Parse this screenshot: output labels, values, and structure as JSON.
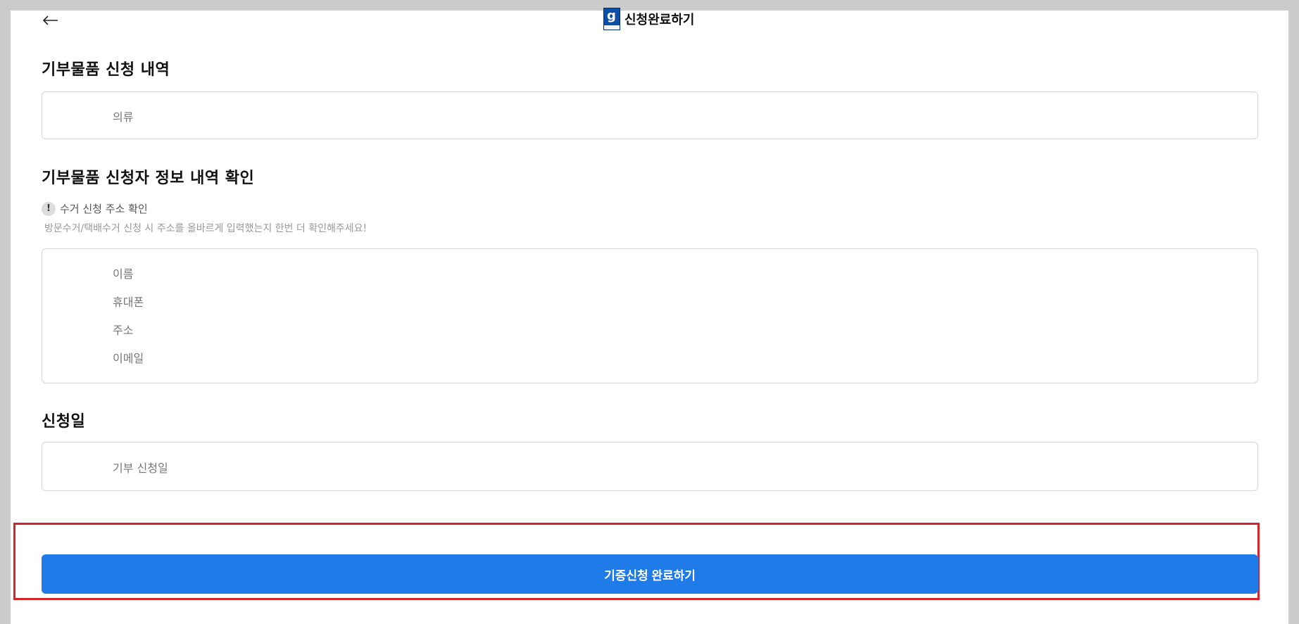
{
  "header": {
    "back_icon": "arrow-left-icon",
    "logo_letter": "g",
    "title": "신청완료하기"
  },
  "items_section": {
    "title": "기부물품 신청 내역",
    "rows": [
      "의류"
    ]
  },
  "applicant_section": {
    "title": "기부물품 신청자 정보 내역 확인",
    "notice_icon": "!",
    "notice_title": "수거 신청 주소 확인",
    "notice_desc": "방문수거/택배수거 신청 시 주소를 올바르게 입력했는지 한번 더 확인해주세요!",
    "rows": [
      "이름",
      "휴대폰",
      "주소",
      "이메일"
    ]
  },
  "date_section": {
    "title": "신청일",
    "rows": [
      "기부 신청일"
    ]
  },
  "cta": {
    "label": "기증신청 완료하기",
    "color": "#1e7be7",
    "highlight_color": "#d8232a"
  }
}
